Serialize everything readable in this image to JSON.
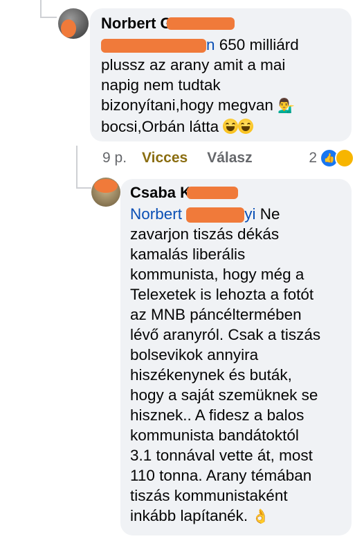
{
  "comment1": {
    "author": "Norbert G",
    "mention_suffix": "n",
    "text_after_mention": " 650 milliárd",
    "lines": [
      "plussz az arany amit a mai",
      "napig nem tudtak",
      "bizonyítani,hogy megvan",
      "bocsi,Orbán látta"
    ],
    "man_emoji": "💁‍♂️",
    "time": "9 p.",
    "reaction_label": "Vicces",
    "reply_label": "Válasz",
    "reaction_count": "2"
  },
  "comment2": {
    "author": "Csaba K",
    "mention_prefix": "Norbert",
    "mention_suffix": "yi",
    "first_line_after": " Ne",
    "lines": [
      "zavarjon tiszás dékás",
      "kamalás liberális",
      "kommunista, hogy még a",
      "Telexetek is lehozta a fotót",
      "az MNB páncéltermében",
      "lévő aranyról. Csak a tiszás",
      "bolsevikok annyira",
      "hiszékenynek és buták,",
      "hogy a saját szemüknek se",
      "hisznek.. A fidesz a balos",
      "kommunista bandátoktól",
      "3.1 tonnával vette át, most",
      "110 tonna. Arany témában",
      "tiszás kommunistaként",
      "inkább lapítanék."
    ],
    "ok_emoji": "👌"
  }
}
